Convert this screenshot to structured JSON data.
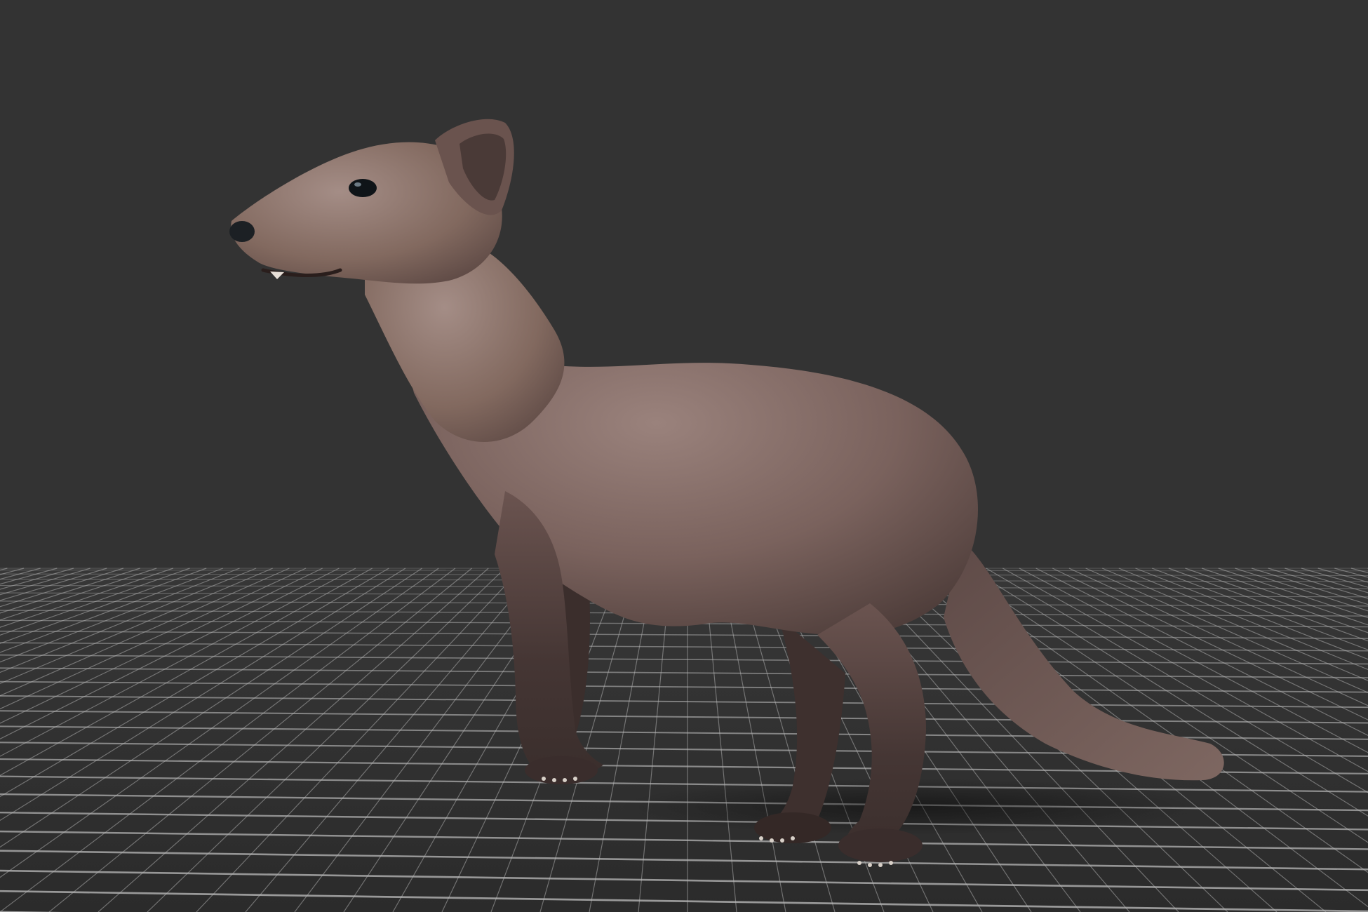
{
  "viewport": {
    "background_color": "#333333",
    "floor_color": "#3a3a3a",
    "grid_line_color": "#b8b8b8",
    "grid_visible": true
  },
  "model": {
    "subject": "marten",
    "fur_color": "#7d6560",
    "fur_highlight_color": "#a08a84",
    "fur_shadow_color": "#4a3a38",
    "leg_dark_color": "#3a2d2c",
    "eye_color": "#0f1418",
    "nose_color": "#1c2024",
    "claw_color": "#d8d0c8"
  }
}
